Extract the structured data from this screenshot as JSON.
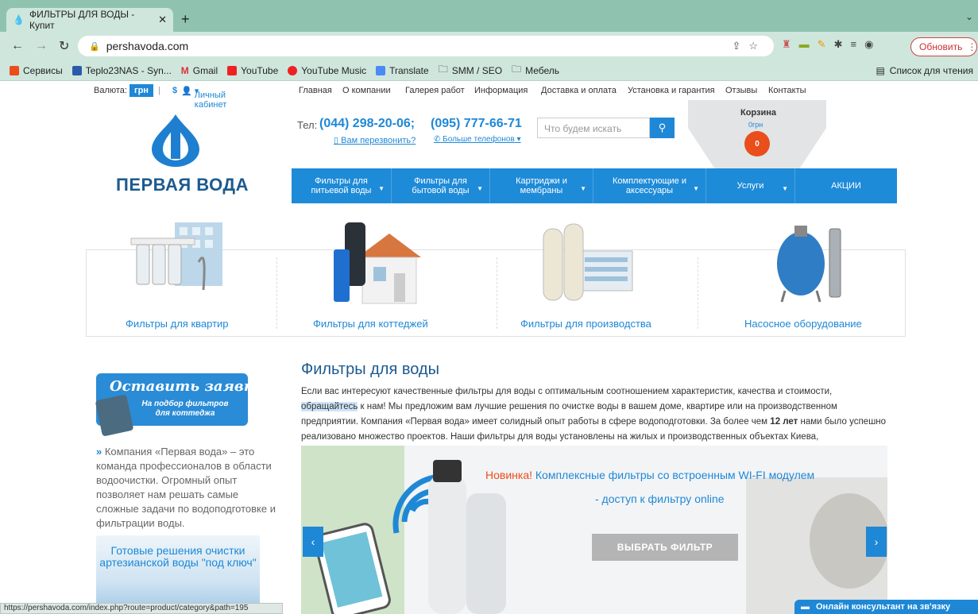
{
  "browser": {
    "tab_title": "ФИЛЬТРЫ ДЛЯ ВОДЫ - Купит",
    "url": "pershavoda.com",
    "update_label": "Обновить",
    "bookmarks": [
      "Сервисы",
      "Teplo23NAS - Syn...",
      "Gmail",
      "YouTube",
      "YouTube Music",
      "Translate",
      "SMM / SEO",
      "Мебель"
    ],
    "reading_list": "Список для чтения",
    "status_url": "https://pershavoda.com/index.php?route=product/category&path=195"
  },
  "topbar": {
    "currency_label": "Валюта:",
    "currency_active": "грн",
    "currency_alt": "$",
    "cabinet": "Личный кабинет",
    "nav": [
      "Главная",
      "О компании",
      "Галерея работ",
      "Информация",
      "Доставка и оплата",
      "Установка и гарантия",
      "Отзывы",
      "Контакты"
    ]
  },
  "header": {
    "logo": "ПЕРВАЯ ВОДА",
    "tel_label": "Тел:",
    "tel1": "(044) 298-20-06;",
    "tel2": "(095) 777-66-71",
    "callback": "Вам перезвонить?",
    "more_phones": "Больше телефонов",
    "search_placeholder": "Что будем искать",
    "cart_title": "Корзина",
    "cart_sum": "0грн",
    "cart_count": "0"
  },
  "menu": [
    {
      "label": "Фильтры для питьевой воды",
      "caret": true
    },
    {
      "label": "Фильтры для бытовой воды",
      "caret": true
    },
    {
      "label": "Картриджи и мембраны",
      "caret": true
    },
    {
      "label": "Комплектующие и аксессуары",
      "caret": true
    },
    {
      "label": "Услуги",
      "caret": true
    },
    {
      "label": "АКЦИИ",
      "caret": false
    }
  ],
  "categories": [
    "Фильтры для квартир",
    "Фильтры для коттеджей",
    "Фильтры для производства",
    "Насосное оборудование"
  ],
  "sidebar": {
    "order_title": "Оставить заявку",
    "order_sub": "На подбор фильтров для коттеджа",
    "about": "Компания «Первая вода» – это команда профессионалов в области водоочистки. Огромный опыт позволяет нам решать самые сложные задачи по водоподготовке и фильтрации воды.",
    "ready": "Готовые решения очистки артезианской воды \"под ключ\""
  },
  "content": {
    "title": "Фильтры для воды",
    "intro_1": "Если вас интересуют качественные фильтры для воды с оптимальным соотношением характеристик, качества и стоимости, ",
    "intro_highlight": "обращайтесь",
    "intro_2": " к нам! Мы предложим вам лучшие решения по очистке воды в вашем доме, квартире или на производственном предприятии. Компания «Первая вода» имеет солидный опыт работы в сфере водоподготовки. За более чем ",
    "intro_bold": "12 лет",
    "intro_3": " нами было успешно реализовано множество проектов. Наши фильтры для воды установлены на жилых и производственных объектах Киева, Днепропетровска и других городов."
  },
  "slider": {
    "novelty": "Новинка!",
    "title": "Комплексные фильтры со встроенным WI-FI модулем",
    "subtitle": "- доступ к фильтру online",
    "button": "ВЫБРАТЬ ФИЛЬТР"
  },
  "chat": "Онлайн консультант на зв'язку",
  "colors": {
    "accent": "#1e88d6",
    "orange": "#e94e1b",
    "browser": "#cfe6dd"
  }
}
